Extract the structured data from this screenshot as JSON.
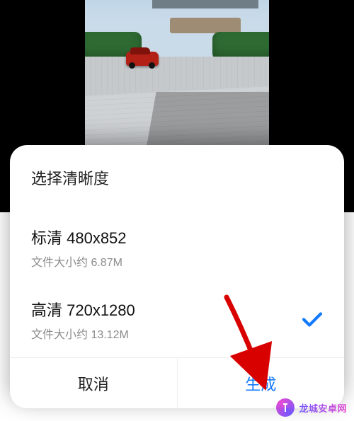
{
  "sheet": {
    "title": "选择清晰度",
    "options": [
      {
        "label": "标清 480x852",
        "sub": "文件大小约 6.87M",
        "selected": false
      },
      {
        "label": "高清 720x1280",
        "sub": "文件大小约 13.12M",
        "selected": true
      }
    ],
    "cancel": "取消",
    "confirm": "生成"
  },
  "watermark": {
    "text": "龙城安卓网"
  },
  "colors": {
    "primary": "#147aff",
    "arrow": "#d90000"
  }
}
